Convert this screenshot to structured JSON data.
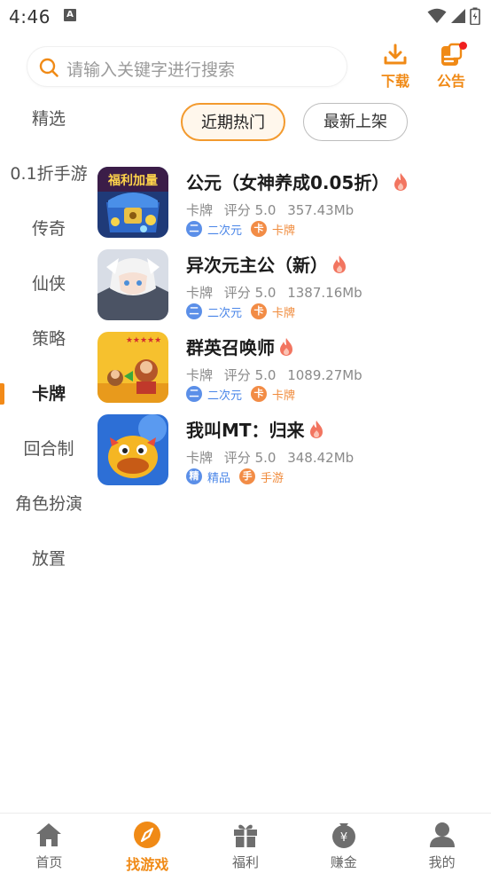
{
  "status_bar": {
    "time": "4:46",
    "notif_letter": "A"
  },
  "header": {
    "search_placeholder": "请输入关键字进行搜索",
    "download_label": "下载",
    "notice_label": "公告"
  },
  "sidebar": {
    "categories": [
      "精选",
      "0.1折手游",
      "传奇",
      "仙侠",
      "策略",
      "卡牌",
      "回合制",
      "角色扮演",
      "放置"
    ],
    "active_index": 5
  },
  "tabs": [
    {
      "label": "近期热门",
      "active": true
    },
    {
      "label": "最新上架",
      "active": false
    }
  ],
  "games": [
    {
      "title": "公元（女神养成0.05折）",
      "icon_text": "福利加量",
      "category": "卡牌",
      "rating": "评分 5.0",
      "size": "357.43Mb",
      "tags": [
        {
          "glyph": "二",
          "label": "二次元",
          "color": "blue"
        },
        {
          "glyph": "卡",
          "label": "卡牌",
          "color": "orange"
        }
      ],
      "hot": true
    },
    {
      "title": "异次元主公（新）",
      "category": "卡牌",
      "rating": "评分 5.0",
      "size": "1387.16Mb",
      "tags": [
        {
          "glyph": "二",
          "label": "二次元",
          "color": "blue"
        },
        {
          "glyph": "卡",
          "label": "卡牌",
          "color": "orange"
        }
      ],
      "hot": true
    },
    {
      "title": "群英召唤师",
      "icon_text": "★★★★★",
      "category": "卡牌",
      "rating": "评分 5.0",
      "size": "1089.27Mb",
      "tags": [
        {
          "glyph": "二",
          "label": "二次元",
          "color": "blue"
        },
        {
          "glyph": "卡",
          "label": "卡牌",
          "color": "orange"
        }
      ],
      "hot": true
    },
    {
      "title": "我叫MT：归来",
      "category": "卡牌",
      "rating": "评分 5.0",
      "size": "348.42Mb",
      "tags": [
        {
          "glyph": "精",
          "label": "精品",
          "color": "blue"
        },
        {
          "glyph": "手",
          "label": "手游",
          "color": "orange"
        }
      ],
      "hot": true
    }
  ],
  "bottom_nav": [
    {
      "label": "首页",
      "icon": "home-icon",
      "active": false
    },
    {
      "label": "找游戏",
      "icon": "compass-icon",
      "active": true
    },
    {
      "label": "福利",
      "icon": "gift-icon",
      "active": false
    },
    {
      "label": "赚金",
      "icon": "money-bag-icon",
      "active": false
    },
    {
      "label": "我的",
      "icon": "user-icon",
      "active": false
    }
  ],
  "colors": {
    "accent": "#f08a16",
    "tag_blue": "#4a86e8",
    "tag_orange": "#f08b3c",
    "hot_red": "#f26b5b"
  }
}
